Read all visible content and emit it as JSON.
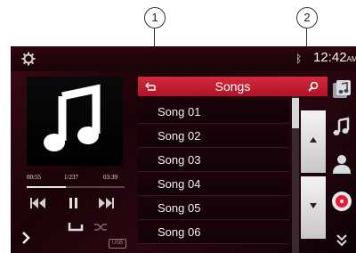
{
  "callouts": [
    "1",
    "2"
  ],
  "status": {
    "clock_time": "12:42",
    "clock_ampm": "AM"
  },
  "player": {
    "elapsed": "00:55",
    "track_position": "1/237",
    "duration": "03:39",
    "progress_fraction": 0.4,
    "source_badge": "USB"
  },
  "list": {
    "title": "Songs",
    "songs": [
      "Song 01",
      "Song 02",
      "Song 03",
      "Song 04",
      "Song 05",
      "Song 06"
    ]
  },
  "colors": {
    "accent": "#c8203a",
    "background": "#1a0408",
    "text": "#f0f0f0"
  },
  "icons": [
    "settings-gear-icon",
    "bluetooth-icon",
    "music-note-icon",
    "back-icon",
    "search-icon",
    "previous-track-icon",
    "pause-icon",
    "next-track-icon",
    "repeat-icon",
    "shuffle-icon",
    "expand-arrow-icon",
    "scroll-up-icon",
    "scroll-down-icon",
    "album-list-icon",
    "music-icon",
    "artist-icon",
    "disc-icon",
    "more-chevron-icon"
  ]
}
